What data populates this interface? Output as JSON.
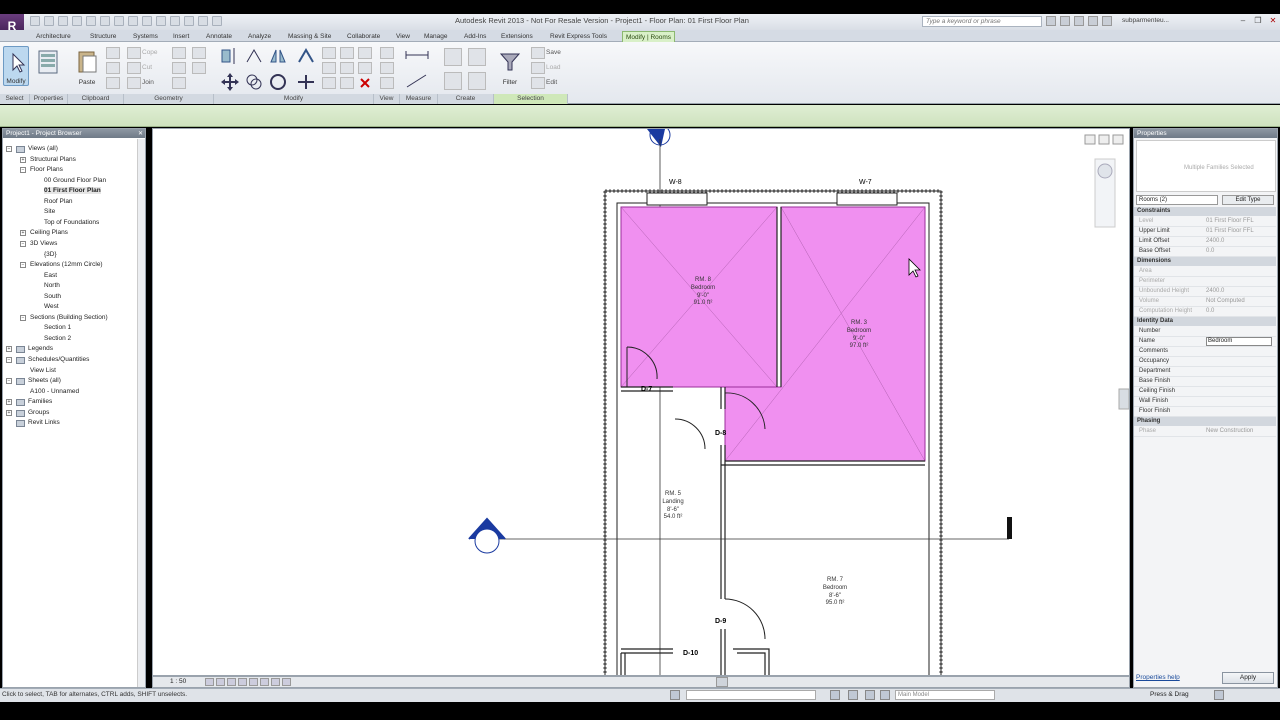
{
  "app": {
    "logo": "R",
    "window_title": "Autodesk Revit 2013 - Not For Resale Version -   Project1 - Floor Plan: 01 First Floor Plan",
    "search_placeholder": "Type a keyword or phrase",
    "user": "subparmenteu..."
  },
  "ribbon": {
    "tabs": [
      "Architecture",
      "Structure",
      "Systems",
      "Insert",
      "Annotate",
      "Analyze",
      "Massing & Site",
      "Collaborate",
      "View",
      "Manage",
      "Add-Ins",
      "Extensions",
      "Revit Express Tools",
      "Modify | Rooms"
    ],
    "active_tab": "Modify | Rooms",
    "buttons": {
      "modify": "Modify",
      "paste": "Paste",
      "cope": "Cope",
      "cut": "Cut",
      "join": "Join",
      "filter": "Filter",
      "save": "Save",
      "load": "Load",
      "edit": "Edit"
    },
    "panels": [
      "Select",
      "Properties",
      "Clipboard",
      "Geometry",
      "Modify",
      "View",
      "Measure",
      "Create",
      "Selection"
    ]
  },
  "project_browser": {
    "title": "Project1 - Project Browser",
    "items": [
      {
        "label": "Views (all)",
        "expander": "−"
      },
      {
        "label": "Structural Plans",
        "expander": "+"
      },
      {
        "label": "Floor Plans",
        "expander": "−"
      },
      {
        "label": "00 Ground Floor Plan",
        "expander": ""
      },
      {
        "label": "01 First Floor Plan",
        "expander": ""
      },
      {
        "label": "Roof Plan",
        "expander": ""
      },
      {
        "label": "Site",
        "expander": ""
      },
      {
        "label": "Top of Foundations",
        "expander": ""
      },
      {
        "label": "Ceiling Plans",
        "expander": "+"
      },
      {
        "label": "3D Views",
        "expander": "−"
      },
      {
        "label": "{3D}",
        "expander": ""
      },
      {
        "label": "Elevations (12mm Circle)",
        "expander": "−"
      },
      {
        "label": "East",
        "expander": ""
      },
      {
        "label": "North",
        "expander": ""
      },
      {
        "label": "South",
        "expander": ""
      },
      {
        "label": "West",
        "expander": ""
      },
      {
        "label": "Sections (Building Section)",
        "expander": "−"
      },
      {
        "label": "Section 1",
        "expander": ""
      },
      {
        "label": "Section 2",
        "expander": ""
      },
      {
        "label": "Legends",
        "expander": "+"
      },
      {
        "label": "Schedules/Quantities",
        "expander": "−"
      },
      {
        "label": "View List",
        "expander": ""
      },
      {
        "label": "Sheets (all)",
        "expander": "−"
      },
      {
        "label": "A100 - Unnamed",
        "expander": ""
      },
      {
        "label": "Families",
        "expander": "+"
      },
      {
        "label": "Groups",
        "expander": "+"
      },
      {
        "label": "Revit Links",
        "expander": ""
      }
    ]
  },
  "canvas": {
    "windows": [
      "W-8",
      "W-7"
    ],
    "doors": [
      "D-7",
      "D-8",
      "D-9",
      "D-10"
    ],
    "rooms": [
      {
        "name": "RM. 8",
        "type": "Bedroom",
        "dim": "9'-0\"",
        "area": "91.0 ft²"
      },
      {
        "name": "RM. 3",
        "type": "Bedroom",
        "dim": "9'-0\"",
        "area": "97.0 ft²"
      },
      {
        "name": "RM. 5",
        "type": "Landing",
        "dim": "8'-6\"",
        "area": "54.0 ft²"
      },
      {
        "name": "RM. 7",
        "type": "Bedroom",
        "dim": "8'-6\"",
        "area": "95.0 ft²"
      }
    ],
    "scale": "1 : 50"
  },
  "properties": {
    "title": "Properties",
    "type_label": "Multiple Families Selected",
    "filter": "Rooms (2)",
    "edit_type": "Edit Type",
    "sections": [
      {
        "name": "Constraints",
        "rows": [
          {
            "k": "Level",
            "v": "01 First Floor FFL",
            "dim": true
          },
          {
            "k": "Upper Limit",
            "v": "01 First Floor FFL",
            "dim": false
          },
          {
            "k": "Limit Offset",
            "v": "2400.0",
            "dim": false
          },
          {
            "k": "Base Offset",
            "v": "0.0",
            "dim": false
          }
        ]
      },
      {
        "name": "Dimensions",
        "rows": [
          {
            "k": "Area",
            "v": "",
            "dim": true
          },
          {
            "k": "Perimeter",
            "v": "",
            "dim": true
          },
          {
            "k": "Unbounded Height",
            "v": "2400.0",
            "dim": true
          },
          {
            "k": "Volume",
            "v": "Not Computed",
            "dim": true
          },
          {
            "k": "Computation Height",
            "v": "0.0",
            "dim": true
          }
        ]
      },
      {
        "name": "Identity Data",
        "rows": [
          {
            "k": "Number",
            "v": "",
            "dim": false
          },
          {
            "k": "Name",
            "v": "Bedroom",
            "dim": false
          },
          {
            "k": "Comments",
            "v": "",
            "dim": false
          },
          {
            "k": "Occupancy",
            "v": "",
            "dim": false
          },
          {
            "k": "Department",
            "v": "",
            "dim": false
          },
          {
            "k": "Base Finish",
            "v": "",
            "dim": false
          },
          {
            "k": "Ceiling Finish",
            "v": "",
            "dim": false
          },
          {
            "k": "Wall Finish",
            "v": "",
            "dim": false
          },
          {
            "k": "Floor Finish",
            "v": "",
            "dim": false
          }
        ]
      },
      {
        "name": "Phasing",
        "rows": [
          {
            "k": "Phase",
            "v": "New Construction",
            "dim": true
          }
        ]
      }
    ],
    "help": "Properties help",
    "apply": "Apply"
  },
  "status": {
    "text": "Click to select, TAB for alternates, CTRL adds, SHIFT unselects.",
    "model": "Main Model",
    "press_drag": "Press & Drag"
  },
  "colors": {
    "room_fill": "#f090f0",
    "room_stroke": "#9a2e9a",
    "active_tab": "#d9f0c8",
    "elevation_marker": "#1a3aa0"
  }
}
